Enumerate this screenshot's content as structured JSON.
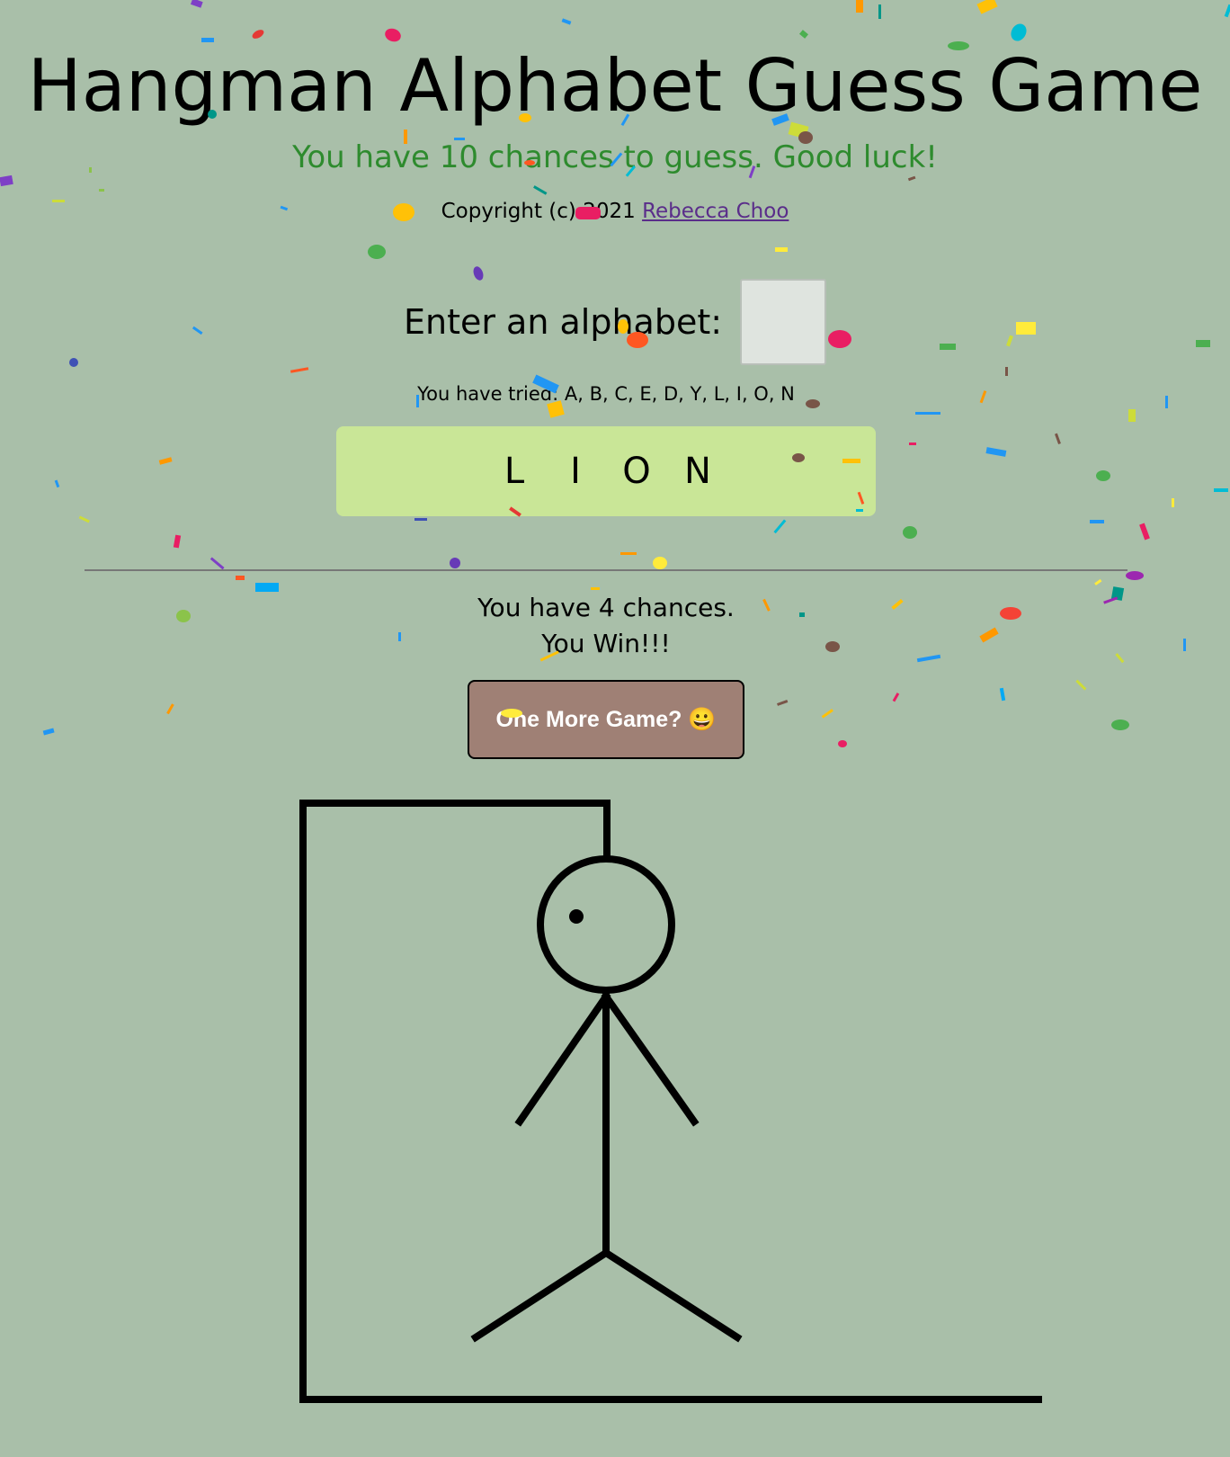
{
  "title": "Hangman Alphabet Guess Game",
  "subtitle": "You have 10 chances to guess. Good luck!",
  "copyright": {
    "text": "Copyright (c) 2021",
    "author": "Rebecca Choo"
  },
  "input": {
    "label": "Enter an alphabet:",
    "value": ""
  },
  "tried": {
    "label": "You have tried:",
    "letters": "A, B, C, E, D, Y, L, I, O, N"
  },
  "word": [
    "L",
    "I",
    "O",
    "N"
  ],
  "status": {
    "chances": "You have 4 chances.",
    "result": "You Win!!!"
  },
  "button": {
    "label": "One More Game? 😀"
  },
  "colors": {
    "background": "#a9bfa9",
    "subtitle": "#2e8b2e",
    "word_box": "#c9e697",
    "button": "#9f8075",
    "link": "#5a2d8a"
  }
}
